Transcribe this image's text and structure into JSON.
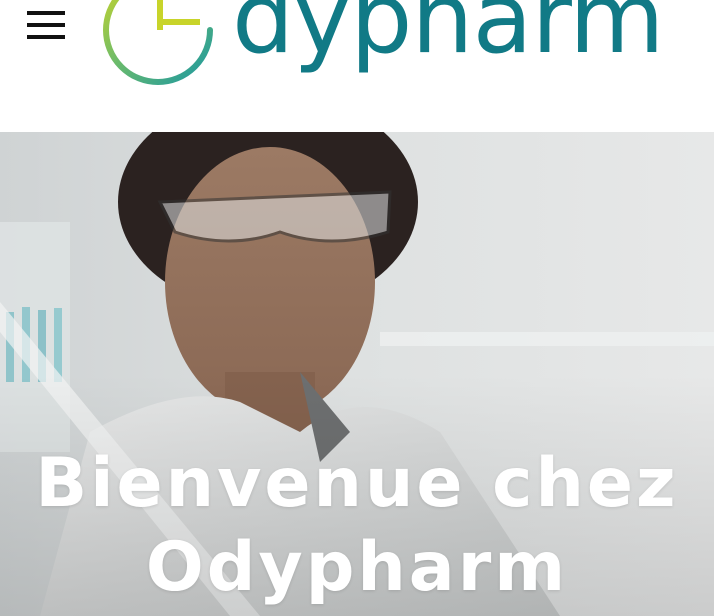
{
  "header": {
    "menu_icon": "hamburger-icon",
    "logo": {
      "text": "dypharm",
      "mark_icon": "odypharm-logo-mark",
      "colors": {
        "text": "#117a86",
        "ring": "#1ca39e",
        "accent": "#c8d42a"
      }
    }
  },
  "hero": {
    "title_line1": "Bienvenue chez",
    "title_line2": "Odypharm",
    "title_color": "#ffffff"
  }
}
